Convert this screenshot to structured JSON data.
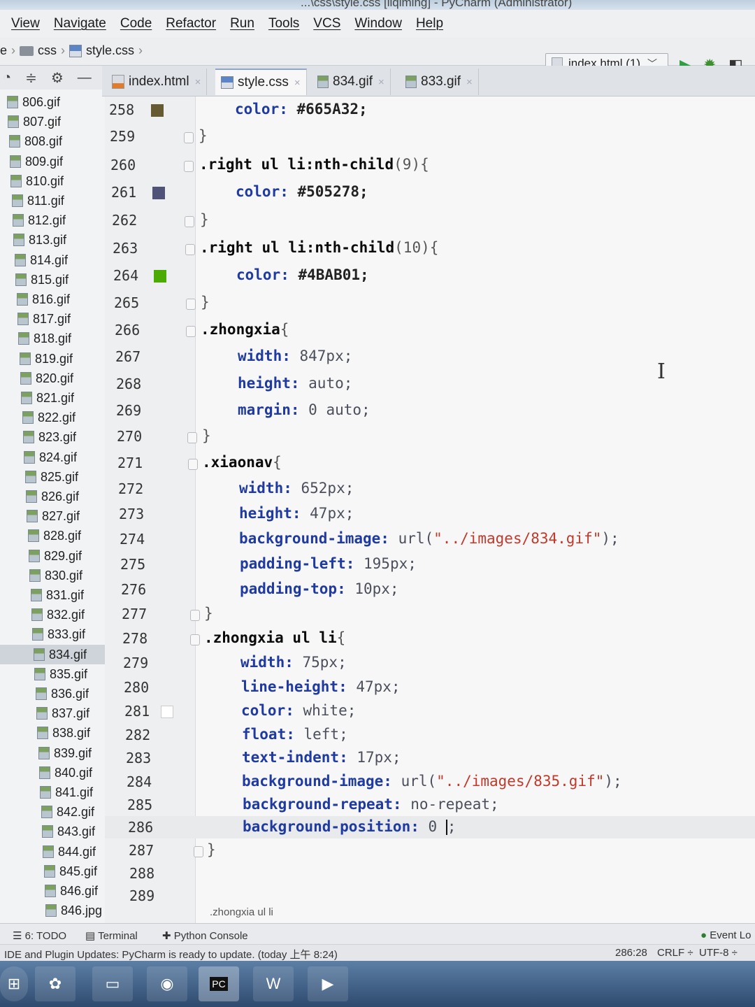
{
  "window": {
    "title": "...\\css\\style.css [liqiming] - PyCharm (Administrator)"
  },
  "menu": [
    "View",
    "Navigate",
    "Code",
    "Refactor",
    "Run",
    "Tools",
    "VCS",
    "Window",
    "Help"
  ],
  "navbar": {
    "crumbs": [
      "e",
      "css",
      "style.css"
    ],
    "run_config": "index.html (1)"
  },
  "tabs": [
    {
      "label": "index.html",
      "icon": "html-file-icon",
      "active": false
    },
    {
      "label": "style.css",
      "icon": "css-file-icon",
      "active": true
    },
    {
      "label": "834.gif",
      "icon": "gif-file-icon",
      "active": false
    },
    {
      "label": "833.gif",
      "icon": "gif-file-icon",
      "active": false
    }
  ],
  "sidebar": {
    "files": [
      "806.gif",
      "807.gif",
      "808.gif",
      "809.gif",
      "810.gif",
      "811.gif",
      "812.gif",
      "813.gif",
      "814.gif",
      "815.gif",
      "816.gif",
      "817.gif",
      "818.gif",
      "819.gif",
      "820.gif",
      "821.gif",
      "822.gif",
      "823.gif",
      "824.gif",
      "825.gif",
      "826.gif",
      "827.gif",
      "828.gif",
      "829.gif",
      "830.gif",
      "831.gif",
      "832.gif",
      "833.gif",
      "834.gif",
      "835.gif",
      "836.gif",
      "837.gif",
      "838.gif",
      "839.gif",
      "840.gif",
      "841.gif",
      "842.gif",
      "843.gif",
      "844.gif",
      "845.gif",
      "846.gif",
      "846.jpg"
    ],
    "selected": "834.gif"
  },
  "line_numbers": [
    "258",
    "259",
    "260",
    "261",
    "262",
    "263",
    "264",
    "265",
    "266",
    "267",
    "268",
    "269",
    "270",
    "271",
    "272",
    "273",
    "274",
    "275",
    "276",
    "277",
    "278",
    "279",
    "280",
    "281",
    "282",
    "283",
    "284",
    "285",
    "286",
    "287",
    "288",
    "289"
  ],
  "swatches": {
    "l258": "#665A32",
    "l261": "#505278",
    "l264": "#4BAB01",
    "l281": "#FFFFFF"
  },
  "code": {
    "l258": {
      "prop": "color:",
      "val": " #665A32;"
    },
    "l259": {
      "text": "}"
    },
    "l260": {
      "sel": ".right ul li:nth-child",
      "rest": "(9){"
    },
    "l261": {
      "prop": "color:",
      "val": " #505278;"
    },
    "l262": {
      "text": "}"
    },
    "l263": {
      "sel": ".right ul li:nth-child",
      "rest": "(10){"
    },
    "l264": {
      "prop": "color:",
      "val": " #4BAB01;"
    },
    "l265": {
      "text": "}"
    },
    "l266": {
      "sel": ".zhongxia",
      "rest": "{"
    },
    "l267": {
      "prop": "width:",
      "val": " 847px;"
    },
    "l268": {
      "prop": "height:",
      "val": " auto;"
    },
    "l269": {
      "prop": "margin:",
      "val": " 0 auto;"
    },
    "l270": {
      "text": "}"
    },
    "l271": {
      "sel": ".xiaonav",
      "rest": "{"
    },
    "l272": {
      "prop": "width:",
      "val": " 652px;"
    },
    "l273": {
      "prop": "height:",
      "val": " 47px;"
    },
    "l274": {
      "prop": "background-image:",
      "val_a": " url(",
      "str": "\"../images/834.gif\"",
      "val_b": ");"
    },
    "l275": {
      "prop": "padding-left:",
      "val": " 195px;"
    },
    "l276": {
      "prop": "padding-top:",
      "val": " 10px;"
    },
    "l277": {
      "text": "}"
    },
    "l278": {
      "sel": ".zhongxia ul li",
      "rest": "{"
    },
    "l279": {
      "prop": "width:",
      "val": " 75px;"
    },
    "l280": {
      "prop": "line-height:",
      "val": " 47px;"
    },
    "l281": {
      "prop": "color:",
      "val": " white;"
    },
    "l282": {
      "prop": "float:",
      "val": " left;"
    },
    "l283": {
      "prop": "text-indent:",
      "val": " 17px;"
    },
    "l284": {
      "prop": "background-image:",
      "val_a": " url(",
      "str": "\"../images/835.gif\"",
      "val_b": ");"
    },
    "l285": {
      "prop": "background-repeat:",
      "val": " no-repeat;"
    },
    "l286": {
      "prop": "background-position:",
      "val_a": " 0 ",
      "val_b": ";"
    },
    "l287": {
      "text": "}"
    }
  },
  "editor_breadcrumb": ".zhongxia ul li",
  "toolwindows": {
    "todo": "6: TODO",
    "terminal": "Terminal",
    "python_console": "Python Console",
    "event_log": "Event Lo"
  },
  "status": {
    "message": "IDE and Plugin Updates: PyCharm is ready to update. (today 上午 8:24)",
    "position": "286:28",
    "line_sep": "CRLF ÷",
    "encoding": "UTF-8 ÷"
  },
  "taskbar": {
    "pycharm_label": "PC"
  }
}
